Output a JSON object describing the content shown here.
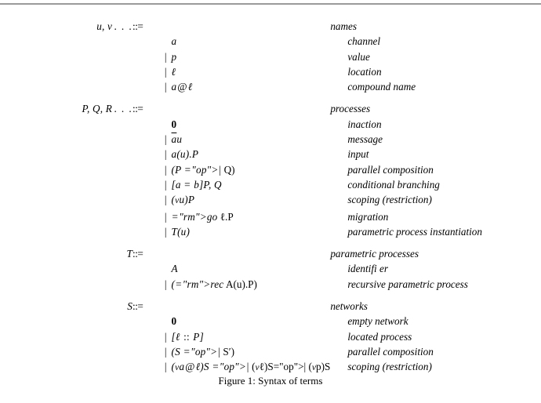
{
  "document": {
    "caption": "Figure 1: Syntax of terms",
    "rule_color": "#9a9a9a",
    "text_color": "#000000",
    "background_color": "#ffffff"
  },
  "grammar": {
    "define_symbol": "::=",
    "alt_symbol": "|",
    "groups": [
      {
        "id": "names",
        "lhs": "u, v . . .",
        "category": "names",
        "productions": [
          {
            "alt": "",
            "syntax": "a",
            "gloss": "channel"
          },
          {
            "alt": "|",
            "syntax": "p",
            "gloss": "value"
          },
          {
            "alt": "|",
            "syntax": "ℓ",
            "gloss": "location"
          },
          {
            "alt": "|",
            "syntax": "a@ℓ",
            "gloss": "compound name"
          }
        ]
      },
      {
        "id": "processes",
        "lhs": "P, Q, R . . .",
        "category": "processes",
        "productions": [
          {
            "alt": "",
            "syntax": "0",
            "gloss": "inaction"
          },
          {
            "alt": "|",
            "syntax": "āu",
            "gloss": "message"
          },
          {
            "alt": "|",
            "syntax": "a(u).P",
            "gloss": "input"
          },
          {
            "alt": "|",
            "syntax": "(P | Q)",
            "gloss": "parallel composition"
          },
          {
            "alt": "|",
            "syntax": "[a = b]P, Q",
            "gloss": "conditional branching"
          },
          {
            "alt": "|",
            "syntax": "(νu)P",
            "gloss": "scoping (restriction)"
          },
          {
            "alt": "|",
            "syntax": "go ℓ.P",
            "gloss": "migration"
          },
          {
            "alt": "|",
            "syntax": "T(u)",
            "gloss": "parametric process instantiation"
          }
        ]
      },
      {
        "id": "parametric-processes",
        "lhs": "T",
        "category": "parametric processes",
        "productions": [
          {
            "alt": "",
            "syntax": "A",
            "gloss": "identifi er"
          },
          {
            "alt": "|",
            "syntax": "(rec A(u).P)",
            "gloss": "recursive parametric process"
          }
        ]
      },
      {
        "id": "networks",
        "lhs": "S",
        "category": "networks",
        "productions": [
          {
            "alt": "",
            "syntax": "0",
            "gloss": "empty network"
          },
          {
            "alt": "|",
            "syntax": "[ℓ :: P]",
            "gloss": "located process"
          },
          {
            "alt": "|",
            "syntax": "(S | S′)",
            "gloss": "parallel composition"
          },
          {
            "alt": "|",
            "syntax": "(νa@ℓ)S | (νℓ)S| (νp)S",
            "gloss": "scoping (restriction)"
          }
        ]
      }
    ]
  }
}
